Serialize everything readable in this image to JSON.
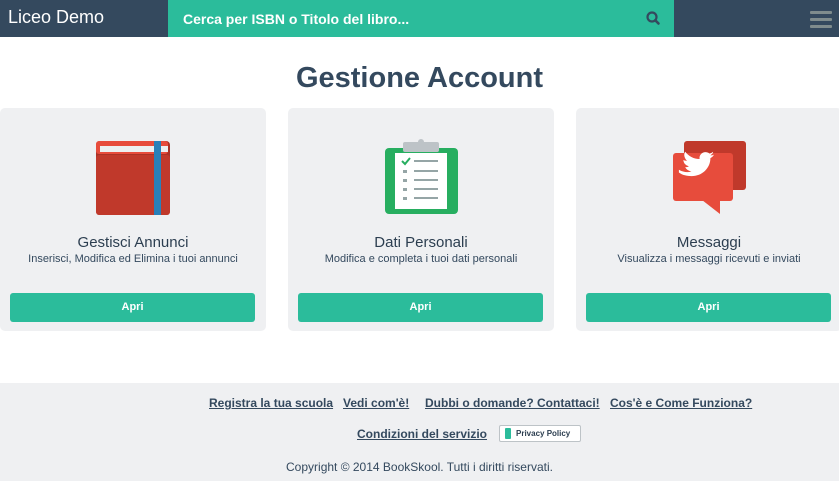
{
  "header": {
    "brand": "Liceo Demo",
    "search_placeholder": "Cerca per ISBN o Titolo del libro..."
  },
  "main": {
    "title": "Gestione Account",
    "cards": [
      {
        "title": "Gestisci Annunci",
        "description": "Inserisci, Modifica ed Elimina i tuoi annunci",
        "button": "Apri",
        "icon": "book-icon"
      },
      {
        "title": "Dati Personali",
        "description": "Modifica e completa i tuoi dati personali",
        "button": "Apri",
        "icon": "clipboard-icon"
      },
      {
        "title": "Messaggi",
        "description": "Visualizza i messaggi ricevuti e inviati",
        "button": "Apri",
        "icon": "chat-bubbles-icon"
      }
    ]
  },
  "footer": {
    "links": [
      "Registra la tua scuola",
      "Vedi com'è!",
      "Dubbi o domande? Contattaci!",
      "Cos'è e Come Funziona?",
      "Condizioni del servizio"
    ],
    "privacy": "Privacy Policy",
    "copyright": "Copyright © 2014 BookSkool. Tutti i diritti riservati."
  },
  "colors": {
    "navbar": "#34495e",
    "accent": "#2bbc9b",
    "card_bg": "#eff0f2",
    "book_red": "#c0392b",
    "clipboard_green": "#27ae60",
    "bubble_red": "#e74c3c"
  }
}
